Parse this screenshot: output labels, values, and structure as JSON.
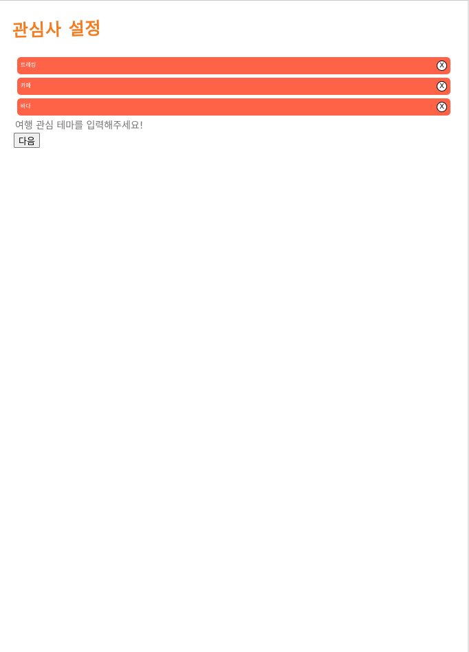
{
  "page": {
    "title": "관심사 설정"
  },
  "tags": [
    {
      "label": "트레킹",
      "remove_label": "X"
    },
    {
      "label": "카페",
      "remove_label": "X"
    },
    {
      "label": "바다",
      "remove_label": "X"
    }
  ],
  "theme_input": {
    "value": "",
    "placeholder": "여행 관심 테마를 입력해주세요!"
  },
  "next_button": {
    "label": "다음"
  },
  "colors": {
    "title": "#f47c20",
    "tag_background": "#ff6347",
    "tag_text": "#ffffff"
  },
  "icons": {
    "tag_remove": "close-circle-icon"
  }
}
